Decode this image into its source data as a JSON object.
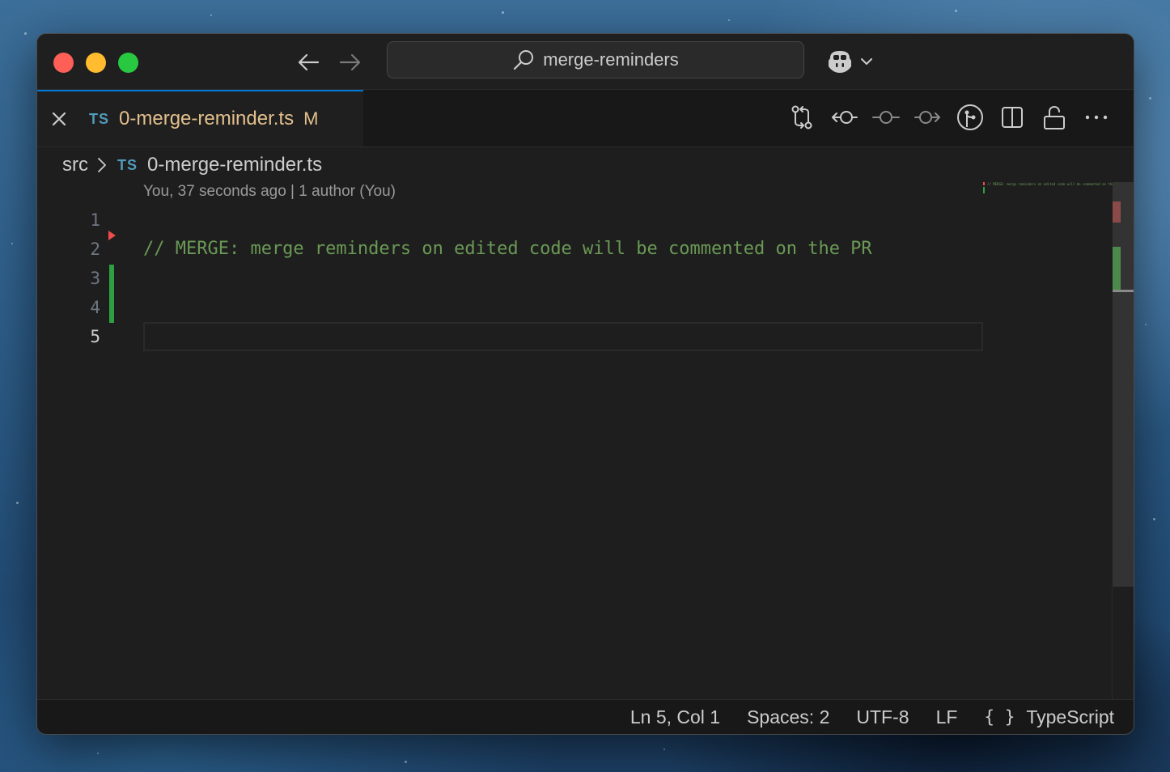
{
  "titlebar": {
    "search_text": "merge-reminders"
  },
  "tab": {
    "lang_badge": "TS",
    "file_name": "0-merge-reminder.ts",
    "git_status": "M"
  },
  "breadcrumb": {
    "folder": "src",
    "lang_badge": "TS",
    "file": "0-merge-reminder.ts"
  },
  "editor": {
    "blame": "You, 37 seconds ago | 1 author (You)",
    "line_numbers": [
      "1",
      "2",
      "3",
      "4",
      "5"
    ],
    "lines": [
      "",
      "// MERGE: merge reminders on edited code will be commented on the PR",
      "",
      "",
      ""
    ],
    "minimap_text": "// MERGE: merge reminders on edited code will be commented on the PR"
  },
  "statusbar": {
    "cursor": "Ln 5, Col 1",
    "indent": "Spaces: 2",
    "encoding": "UTF-8",
    "eol": "LF",
    "language_icon": "{ }",
    "language": "TypeScript"
  },
  "colors": {
    "comment": "#6a9955",
    "modified": "#e2c08d",
    "ts_badge": "#519aba",
    "added_gutter": "#2ea043",
    "deleted_gutter": "#f14c4c",
    "accent": "#0078d4"
  }
}
